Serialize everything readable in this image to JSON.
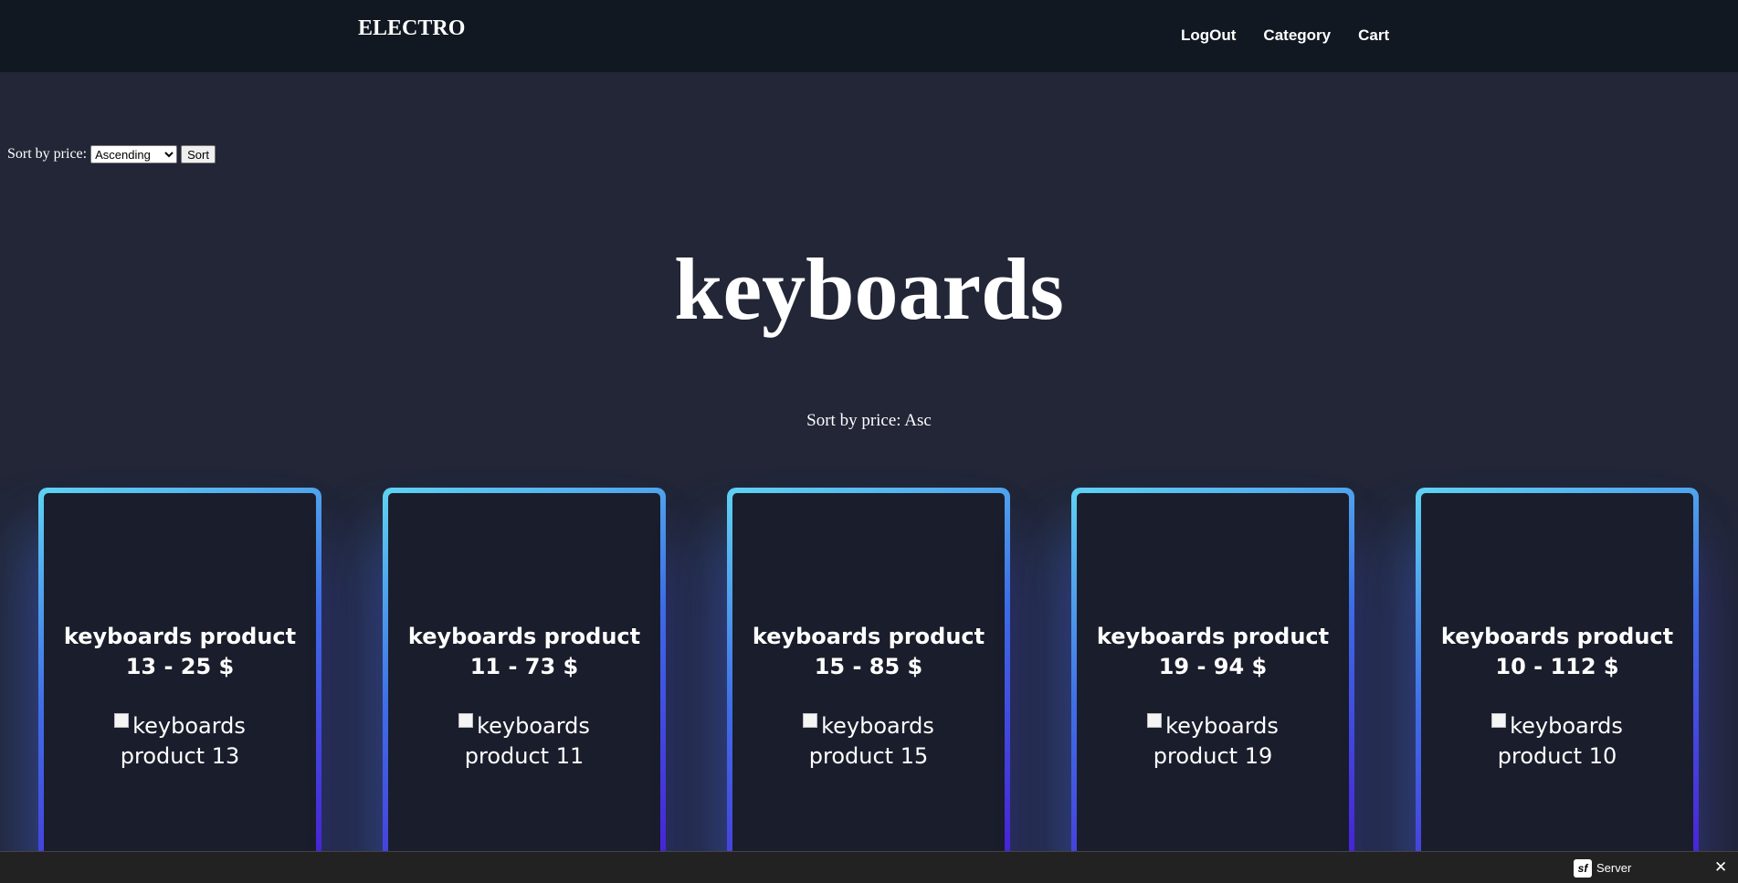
{
  "header": {
    "brand": "ELECTRO",
    "nav": [
      "LogOut",
      "Category",
      "Cart"
    ]
  },
  "sort_form": {
    "label": "Sort by price:",
    "selected": "Ascending",
    "options": [
      "Ascending"
    ],
    "button": "Sort"
  },
  "page_title": "keyboards",
  "sort_status": "Sort by price: Asc",
  "products": [
    {
      "title": "keyboards product 13 - 25 $",
      "image_alt": "keyboards product 13"
    },
    {
      "title": "keyboards product 11 - 73 $",
      "image_alt": "keyboards product 11"
    },
    {
      "title": "keyboards product 15 - 85 $",
      "image_alt": "keyboards product 15"
    },
    {
      "title": "keyboards product 19 - 94 $",
      "image_alt": "keyboards product 19"
    },
    {
      "title": "keyboards product 10 - 112 $",
      "image_alt": "keyboards product 10"
    }
  ],
  "toolbar": {
    "logo": "sf",
    "label": "Server",
    "close": "✕"
  }
}
